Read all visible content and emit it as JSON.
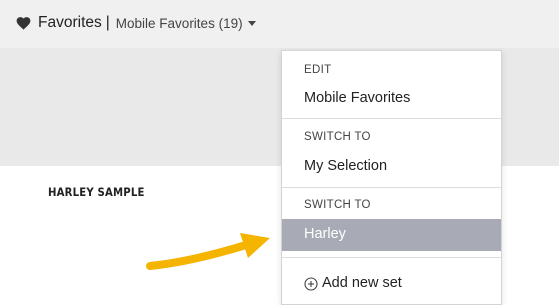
{
  "header": {
    "favorites_label": "Favorites",
    "separator": "|",
    "current_set": "Mobile Favorites (19)"
  },
  "content": {
    "sample_label": "HARLEY SAMPLE"
  },
  "dropdown": {
    "edit_heading": "EDIT",
    "edit_item": "Mobile Favorites",
    "switch_heading_1": "SWITCH TO",
    "switch_item_1": "My Selection",
    "switch_heading_2": "SWITCH TO",
    "switch_item_2": "Harley",
    "add_new_label": "Add new set"
  },
  "colors": {
    "topbar_bg": "#f0f0f0",
    "banner_bg": "#e9e9e9",
    "selected_item_bg": "#a8abb5",
    "arrow": "#f5b400"
  },
  "icons": {
    "heart": "heart-icon",
    "caret": "caret-down-icon",
    "plus": "plus-circle-icon",
    "annotation": "arrow-annotation"
  }
}
